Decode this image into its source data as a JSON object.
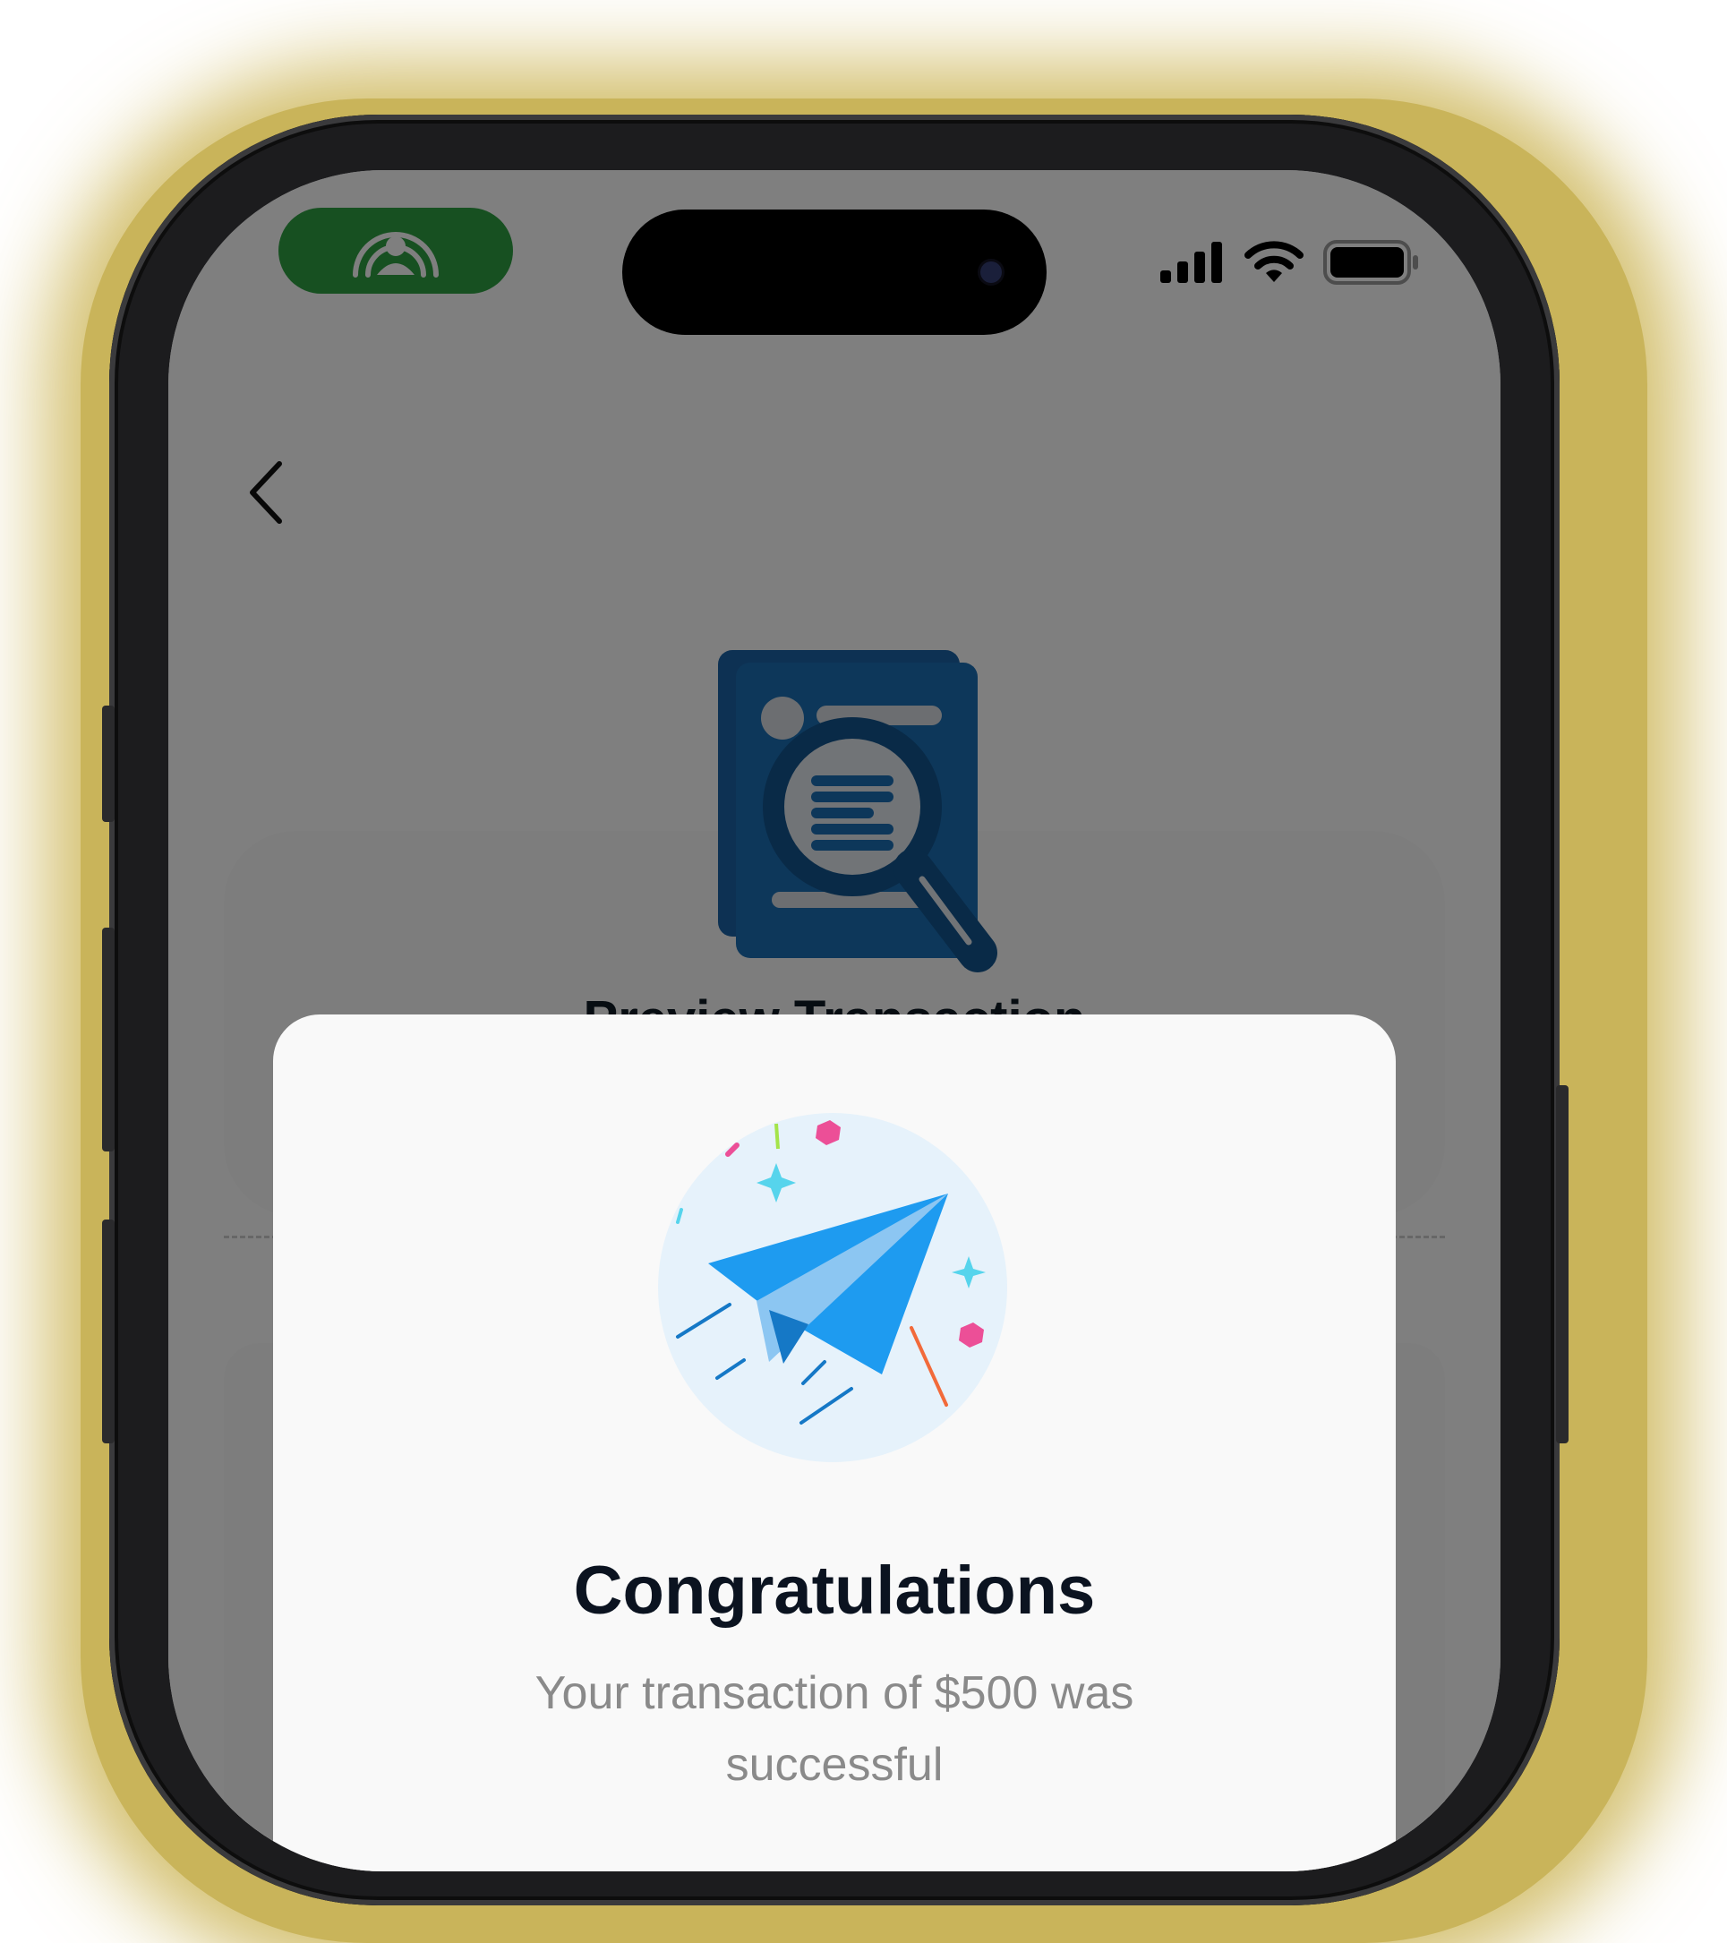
{
  "colors": {
    "accent_green": "#2ea043",
    "doc_blue": "#1b6fb5",
    "plane_blue": "#1e9bf0",
    "modal_bg": "#f9f9f9",
    "title_text": "#0b1320",
    "muted_text": "#8a8a8a"
  },
  "status_bar": {
    "pill_icon": "privacy-person-icon",
    "icons": [
      "signal-bars-icon",
      "wifi-icon",
      "battery-icon"
    ]
  },
  "nav": {
    "back_icon": "chevron-left-icon"
  },
  "header": {
    "illustration": "document-search-icon",
    "title": "Preview Transaction"
  },
  "modal": {
    "illustration": "paper-plane-icon",
    "title": "Congratulations",
    "message": "Your transaction of $500 was successful"
  }
}
